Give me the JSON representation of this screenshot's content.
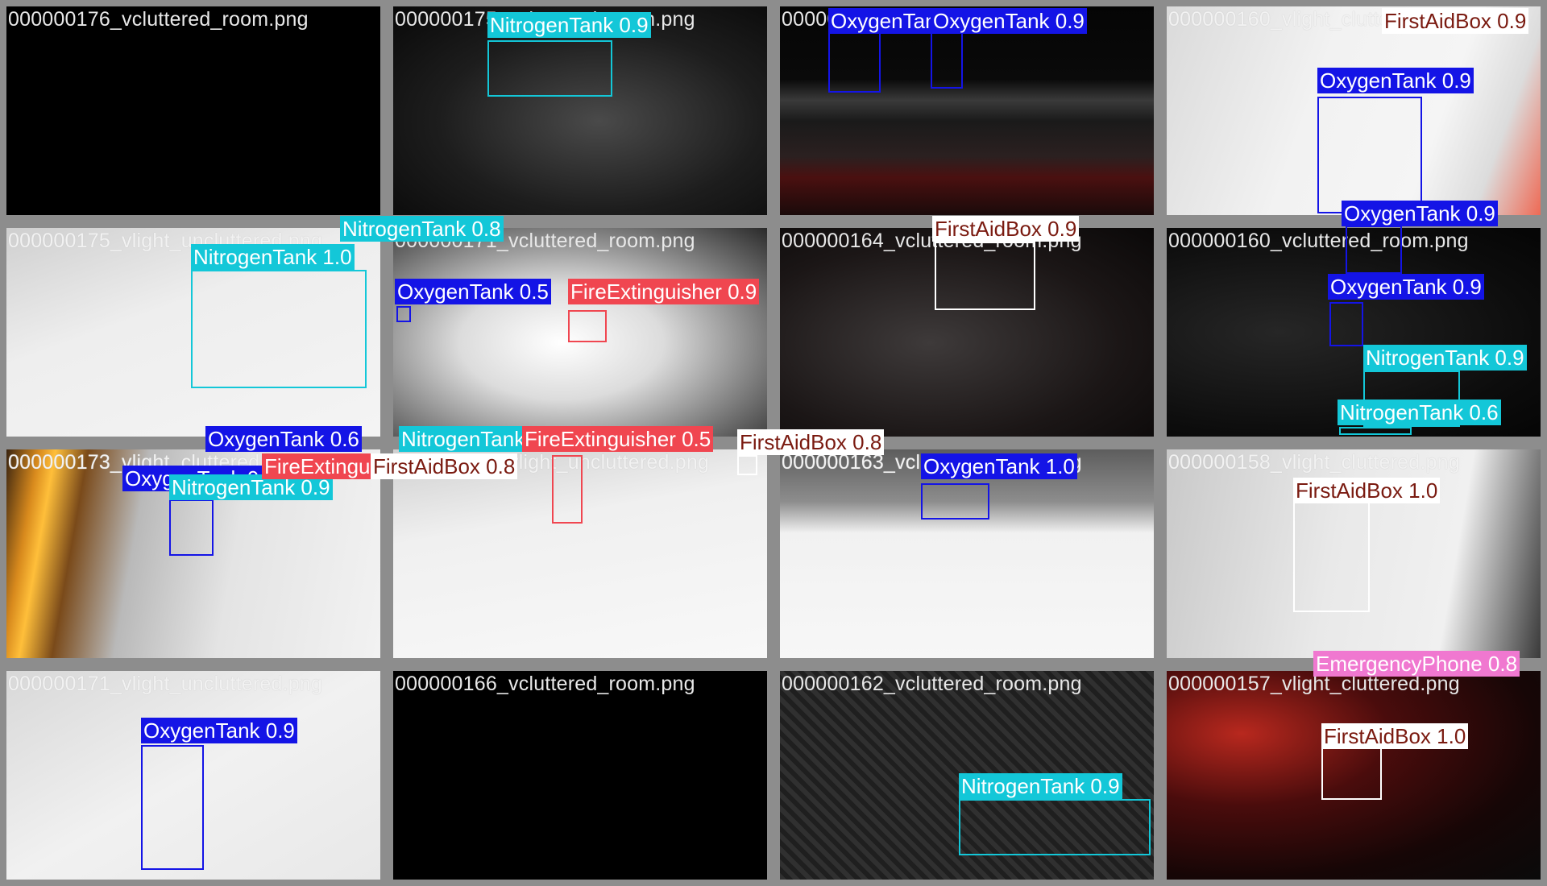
{
  "colors": {
    "OxygenTank": "#1414e6",
    "NitrogenTank": "#13c7d8",
    "FireExtinguisher": "#f04650",
    "FirstAidBox": "#ffffff",
    "EmergencyPhone": "#f078d0"
  },
  "label_text_colors": {
    "OxygenTank": "#ffffff",
    "NitrogenTank": "#ffffff",
    "FireExtinguisher": "#ffffff",
    "FirstAidBox": "#7a1a10",
    "EmergencyPhone": "#ffffff"
  },
  "tiles": [
    {
      "filename": "000000176_vcluttered_room.png"
    },
    {
      "filename": "000000175_vcluttered_room.png"
    },
    {
      "filename": "000000174_vcluttered_room.png"
    },
    {
      "filename": "000000160_vlight_cluttered.png"
    },
    {
      "filename": "000000175_vlight_uncluttered.png"
    },
    {
      "filename": "000000171_vcluttered_room.png"
    },
    {
      "filename": "000000164_vcluttered_room.png"
    },
    {
      "filename": "000000160_vcluttered_room.png"
    },
    {
      "filename": "000000173_vlight_cluttered.png"
    },
    {
      "filename": "000000169_vlight_uncluttered.png"
    },
    {
      "filename": "000000163_vcluttered_room.png"
    },
    {
      "filename": "000000158_vlight_cluttered.png"
    },
    {
      "filename": "000000171_vlight_uncluttered.png"
    },
    {
      "filename": "000000166_vcluttered_room.png"
    },
    {
      "filename": "000000162_vcluttered_room.png"
    },
    {
      "filename": "000000157_vlight_cluttered.png"
    }
  ],
  "detections": [
    {
      "cls": "NitrogenTank",
      "text": "NitrogenTank 0.9"
    },
    {
      "cls": "OxygenTank",
      "text": "OxygenTank 0.9"
    },
    {
      "cls": "OxygenTank",
      "text": "OxygenTank 0.9"
    },
    {
      "cls": "FirstAidBox",
      "text": "FirstAidBox 0.9"
    },
    {
      "cls": "OxygenTank",
      "text": "OxygenTank 0.9"
    },
    {
      "cls": "OxygenTank",
      "text": "OxygenTank 0.9"
    },
    {
      "cls": "NitrogenTank",
      "text": "NitrogenTank 0.8"
    },
    {
      "cls": "NitrogenTank",
      "text": "NitrogenTank 1.0"
    },
    {
      "cls": "OxygenTank",
      "text": "OxygenTank 0.5"
    },
    {
      "cls": "FireExtinguisher",
      "text": "FireExtinguisher 0.9"
    },
    {
      "cls": "FirstAidBox",
      "text": "FirstAidBox 0.9"
    },
    {
      "cls": "OxygenTank",
      "text": "OxygenTank 0.9"
    },
    {
      "cls": "NitrogenTank",
      "text": "NitrogenTank 0.9"
    },
    {
      "cls": "NitrogenTank",
      "text": "NitrogenTank 0.6"
    },
    {
      "cls": "OxygenTank",
      "text": "OxygenTank 0.6"
    },
    {
      "cls": "NitrogenTank",
      "text": "NitrogenTank 0.9"
    },
    {
      "cls": "FireExtinguisher",
      "text": "FireExtinguisher 0.5"
    },
    {
      "cls": "FirstAidBox",
      "text": "FirstAidBox 0.8"
    },
    {
      "cls": "OxygenTank",
      "text": "OxygenTank 0.5"
    },
    {
      "cls": "NitrogenTank",
      "text": "NitrogenTank 0.9"
    },
    {
      "cls": "FireExtinguisher",
      "text": "FireExtinguisher 0.5"
    },
    {
      "cls": "FirstAidBox",
      "text": "FirstAidBox 0.8"
    },
    {
      "cls": "OxygenTank",
      "text": "OxygenTank 1.0"
    },
    {
      "cls": "FirstAidBox",
      "text": "FirstAidBox 1.0"
    },
    {
      "cls": "EmergencyPhone",
      "text": "EmergencyPhone 0.8"
    },
    {
      "cls": "OxygenTank",
      "text": "OxygenTank 0.9"
    },
    {
      "cls": "NitrogenTank",
      "text": "NitrogenTank 0.9"
    },
    {
      "cls": "FirstAidBox",
      "text": "FirstAidBox 1.0"
    }
  ]
}
